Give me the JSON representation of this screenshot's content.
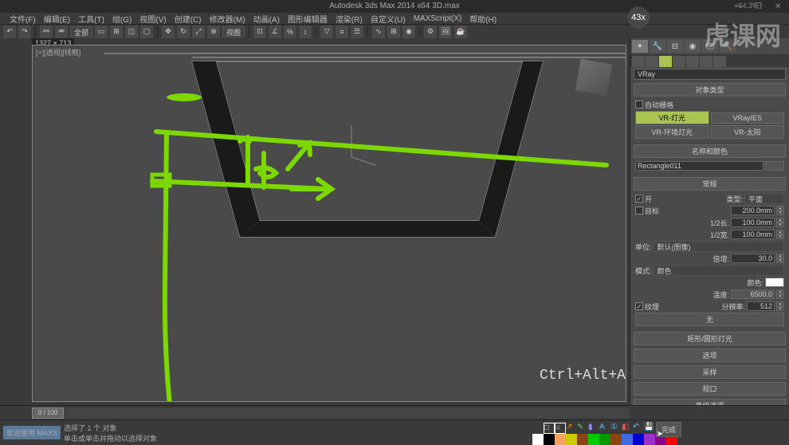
{
  "window": {
    "title": "Autodesk 3ds Max  2014 x64     3D.max",
    "zoom": "+64.3%"
  },
  "speed_badge": "43x",
  "watermark": "虎课网",
  "menu": [
    "文件(F)",
    "编辑(E)",
    "工具(T)",
    "组(G)",
    "视图(V)",
    "创建(C)",
    "修改器(M)",
    "动画(A)",
    "图形编辑器",
    "渲染(R)",
    "自定义(U)",
    "MAXScript(X)",
    "帮助(H)"
  ],
  "toolbar": {
    "dropdown1": "全部",
    "button_view": "视图"
  },
  "viewport": {
    "label": "[+][透视][线框]",
    "dimension": "1327 × 713"
  },
  "side_panel": {
    "renderer": "VRay",
    "rollouts": {
      "object_type": {
        "title": "对象类型",
        "auto_grid": "自动栅格",
        "btn1": "VRayIES",
        "btn2": "VR-灯光",
        "btn3": "VR-环境灯光",
        "btn4": "VR-太阳"
      },
      "name_color": {
        "title": "名称和颜色",
        "name_value": "Rectangle011"
      },
      "general": {
        "title": "常规",
        "enable": "开",
        "type": "类型:",
        "type_value": "平面",
        "target": "目标",
        "target_value": "200.0mm",
        "half_len": "1/2长:",
        "half_len_value": "100.0mm",
        "half_width": "1/2宽:",
        "half_width_value": "100.0mm",
        "units": "单位:",
        "units_value": "默认(图像)",
        "multiplier": "倍增:",
        "multiplier_value": "30.0",
        "mode": "模式:",
        "mode_value": "颜色",
        "color": "颜色:",
        "temperature": "温度:",
        "temperature_value": "6500.0",
        "texture": "纹理",
        "resolution": "分辨率:",
        "resolution_value": "512",
        "none": "无"
      },
      "other": [
        "矩形/圆形灯光",
        "选项",
        "采样",
        "视口",
        "高级选项"
      ]
    }
  },
  "timeline": {
    "frame": "0 / 100"
  },
  "shortcut": "Ctrl+Alt+A",
  "status": {
    "welcome": "欢迎使用 MAXS",
    "selection": "选择了 1 个 对象",
    "hint": "单击或单击并拖动以选择对象",
    "done": "完成"
  },
  "colors": [
    "#ffffff",
    "#000000",
    "#f4a460",
    "#cccc00",
    "#8b4513",
    "#00cc00",
    "#009900",
    "#8b4513",
    "#4169e1",
    "#0000cd",
    "#9932cc",
    "#8b008b",
    "#ff0000"
  ]
}
